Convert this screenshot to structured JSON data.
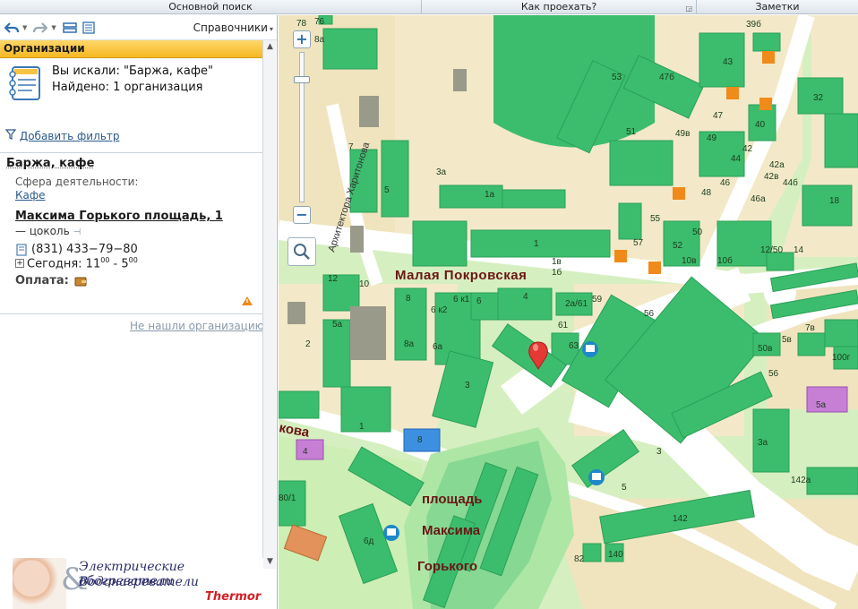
{
  "topbar": {
    "tabs": [
      {
        "label": "Основной поиск",
        "width": 471
      },
      {
        "label": "Как проехать?",
        "width": 307
      },
      {
        "label": "Заметки",
        "width": 180
      }
    ]
  },
  "toolbar": {
    "directories_label": "Справочники"
  },
  "sidebar": {
    "header": "Организации",
    "search_query": "Вы искали: \"Баржа, кафе\"",
    "found_count": "Найдено: 1 организация",
    "add_filter": "Добавить фильтр",
    "not_found_link": "Не нашли организацию?"
  },
  "result": {
    "name": "Баржа, кафе",
    "activity_label": "Сфера деятельности:",
    "activity_value": "Кафе",
    "address": "Максима Горького площадь, 1",
    "floor": "— цоколь",
    "phone": "(831) 433−79−80",
    "hours_prefix": "Сегодня: 11",
    "hours_start_sup": "00",
    "hours_sep": " - 5",
    "hours_end_sup": "00",
    "payment_label": "Оплата:"
  },
  "ad": {
    "line1": "Электрические обогреватели",
    "line2": "Водонагреватели",
    "amp": "&",
    "brand": "Thermor"
  },
  "map": {
    "colors": {
      "background": "#d6efc0",
      "building": "#3cbd6d",
      "building_dark": "#2a9f58",
      "block": "#f3e9c8",
      "road": "#ffffff",
      "pale_green": "#aee6a6",
      "blue_building": "#3d8fe0",
      "purple_building": "#c77fd6",
      "orange_building": "#e2925a",
      "marker": "#e53935"
    },
    "streets": {
      "malaya_pokrovskaya": "Малая Покровская",
      "arkhitektora": "Архитектора Харитонова",
      "kova": "кова",
      "square_line1": "площадь",
      "square_line2": "Максима",
      "square_line3": "Горького"
    },
    "house_numbers": [
      "78",
      "76",
      "8а",
      "53",
      "39б",
      "43",
      "47б",
      "49в",
      "51",
      "49",
      "47",
      "40",
      "42",
      "44",
      "46",
      "42а",
      "42в",
      "44б",
      "46а",
      "48",
      "50",
      "52",
      "32",
      "18",
      "14",
      "12/50",
      "10б",
      "10в",
      "1б",
      "1в",
      "1",
      "1а",
      "3а",
      "5",
      "7",
      "57",
      "55",
      "59",
      "56",
      "61",
      "63",
      "2а/61",
      "4",
      "6",
      "6 к1",
      "6 к2",
      "8",
      "8а",
      "6а",
      "12",
      "10",
      "5а",
      "2",
      "3",
      "1",
      "8",
      "4",
      "6д",
      "80/1",
      "82",
      "140",
      "142",
      "142а",
      "3а",
      "3",
      "5",
      "56",
      "5в",
      "7в",
      "100г",
      "5а",
      "50в"
    ]
  }
}
